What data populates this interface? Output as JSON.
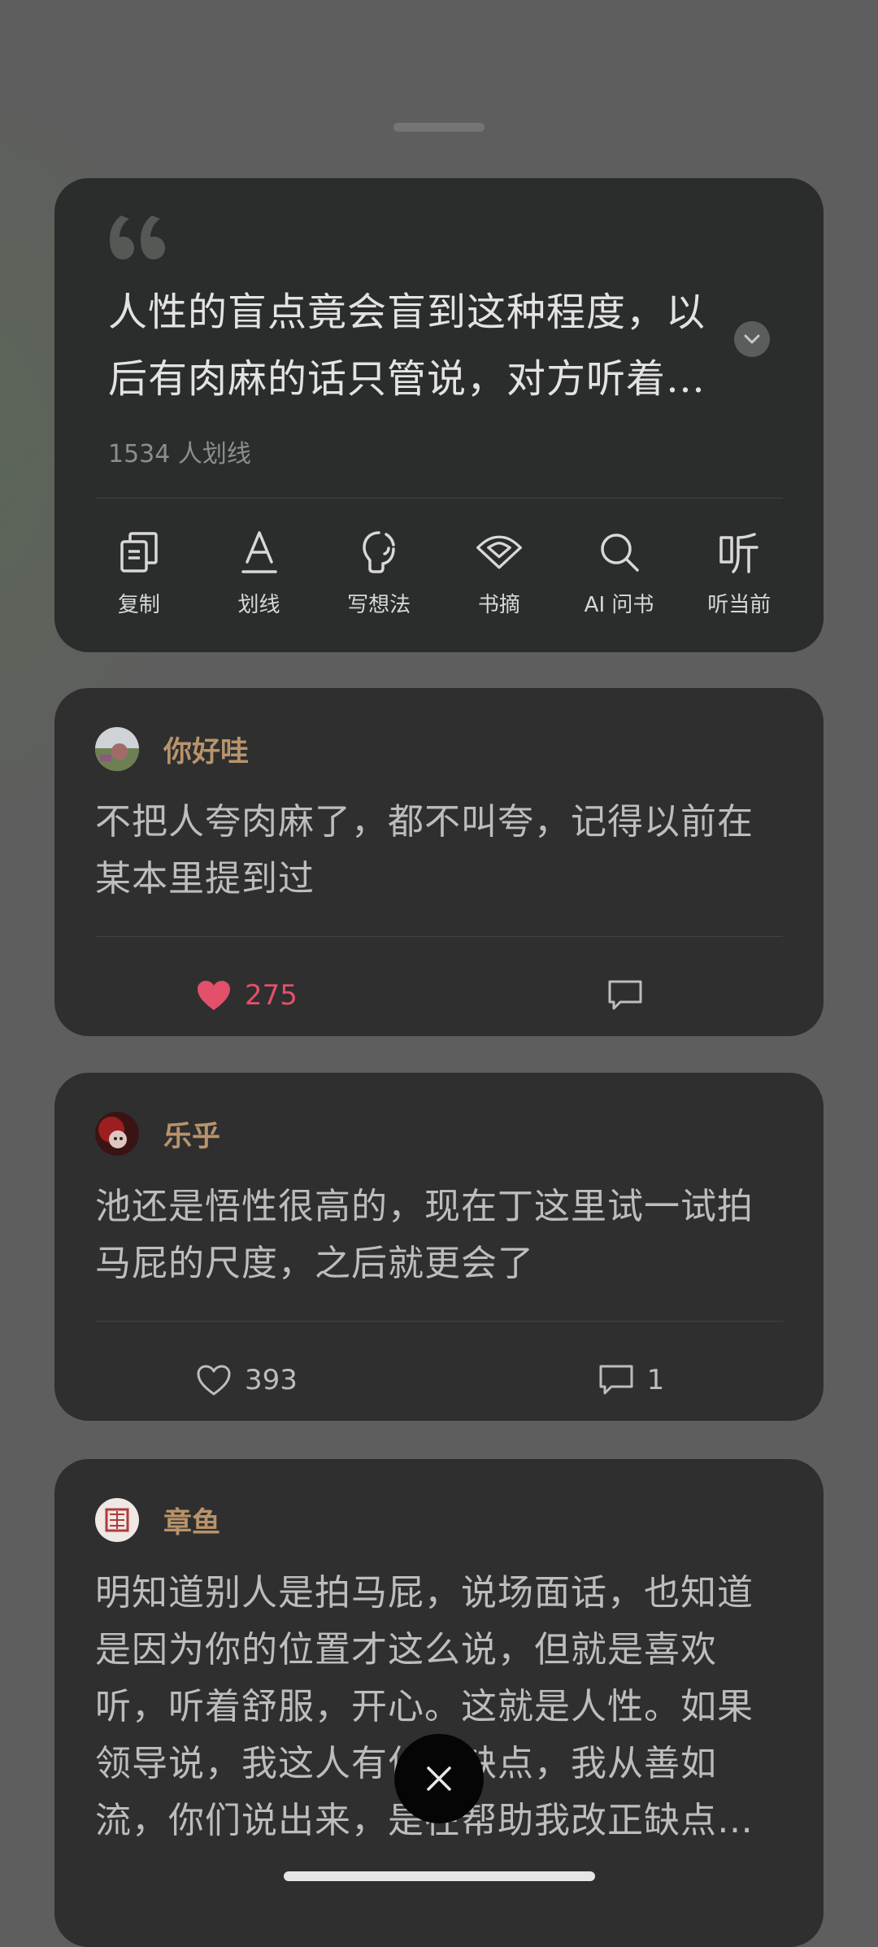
{
  "quote": {
    "lines": [
      "人性的盲点竟会盲到这种程度，以",
      "后有肉麻的话只管说，对方听着…"
    ],
    "highlight_count": "1534 人划线"
  },
  "toolbar": [
    {
      "label": "复制",
      "icon": "copy-icon"
    },
    {
      "label": "划线",
      "icon": "underline-icon"
    },
    {
      "label": "写想法",
      "icon": "thought-icon"
    },
    {
      "label": "书摘",
      "icon": "excerpt-icon"
    },
    {
      "label": "AI 问书",
      "icon": "search-icon"
    },
    {
      "label": "听当前",
      "icon": "listen-icon"
    }
  ],
  "comments": [
    {
      "user": "你好哇",
      "lines": [
        "不把人夸肉麻了，都不叫夸，记得以前在",
        "某本里提到过"
      ],
      "likes": "275",
      "liked": true,
      "replies": ""
    },
    {
      "user": "乐乎",
      "lines": [
        "池还是悟性很高的，现在丁这里试一试拍",
        "马屁的尺度，之后就更会了"
      ],
      "likes": "393",
      "liked": false,
      "replies": "1"
    },
    {
      "user": "章鱼",
      "lines": [
        "明知道别人是拍马屁，说场面话，也知道",
        "是因为你的位置才这么说，但就是喜欢",
        "听，听着舒服，开心。这就是人性。如果",
        "领导说，我这人有什么缺点，我从善如",
        "流，你们说出来，是在帮助我改正缺点…"
      ],
      "likes": "",
      "liked": false,
      "replies": ""
    }
  ],
  "colors": {
    "accent_name": "#b8936b",
    "like_active": "#e2506a",
    "card_bg": "#2f2f2f"
  }
}
